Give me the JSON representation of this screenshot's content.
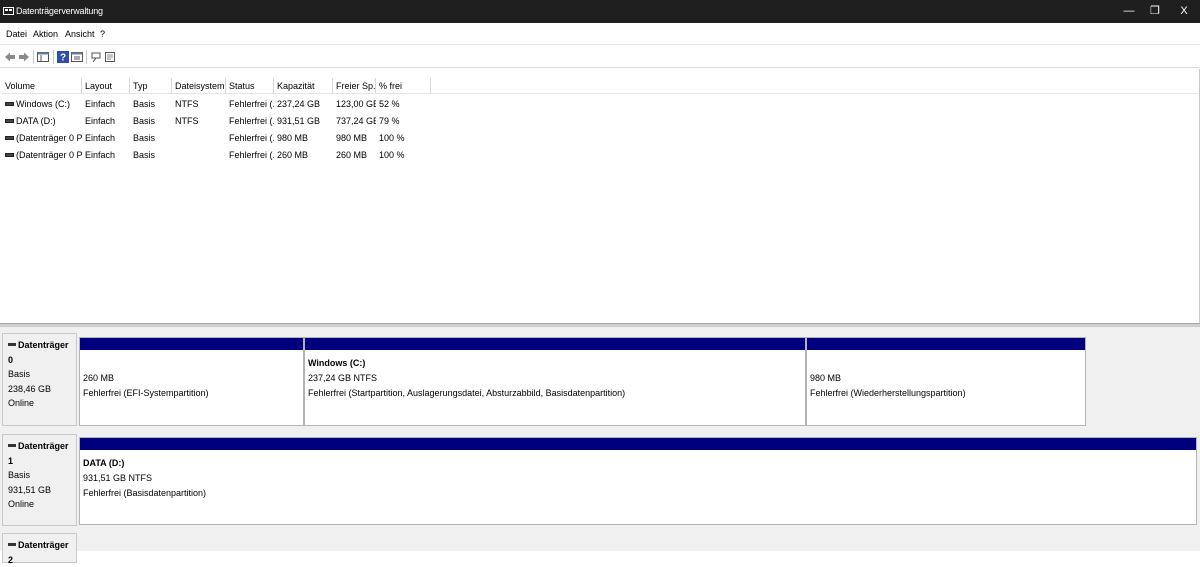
{
  "window": {
    "title": "Datenträgerverwaltung",
    "minimize": "—",
    "restore": "❐",
    "close": "X"
  },
  "menu": [
    "Datei",
    "Aktion",
    "Ansicht",
    "?"
  ],
  "toolbar": {
    "icons": [
      "back-icon",
      "forward-icon",
      "console-tree-icon",
      "help-icon",
      "properties-icon",
      "connect-icon",
      "settings-icon"
    ]
  },
  "volume_list": {
    "columns": [
      "Volume",
      "Layout",
      "Typ",
      "Dateisystem",
      "Status",
      "Kapazität",
      "Freier Sp...",
      "% frei"
    ],
    "rows": [
      [
        "Windows (C:)",
        "Einfach",
        "Basis",
        "NTFS",
        "Fehlerfrei (...",
        "237,24 GB",
        "123,00 GB",
        "52 %"
      ],
      [
        "DATA (D:)",
        "Einfach",
        "Basis",
        "NTFS",
        "Fehlerfrei (...",
        "931,51 GB",
        "737,24 GB",
        "79 %"
      ],
      [
        "(Datenträger 0 Par...",
        "Einfach",
        "Basis",
        "",
        "Fehlerfrei (...",
        "980 MB",
        "980 MB",
        "100 %"
      ],
      [
        "(Datenträger 0 Par...",
        "Einfach",
        "Basis",
        "",
        "Fehlerfrei (...",
        "260 MB",
        "260 MB",
        "100 %"
      ]
    ]
  },
  "disks": [
    {
      "name": "Datenträger 0",
      "type": "Basis",
      "size": "238,46 GB",
      "state": "Online",
      "partitions": [
        {
          "name": "",
          "size": "260 MB",
          "status": "Fehlerfrei (EFI-Systempartition)"
        },
        {
          "name": "Windows  (C:)",
          "size": "237,24 GB NTFS",
          "status": "Fehlerfrei (Startpartition, Auslagerungsdatei, Absturzabbild, Basisdatenpartition)"
        },
        {
          "name": "",
          "size": "980 MB",
          "status": "Fehlerfrei (Wiederherstellungspartition)"
        }
      ]
    },
    {
      "name": "Datenträger 1",
      "type": "Basis",
      "size": "931,51 GB",
      "state": "Online",
      "partitions": [
        {
          "name": "DATA  (D:)",
          "size": "931,51 GB NTFS",
          "status": "Fehlerfrei (Basisdatenpartition)"
        }
      ]
    },
    {
      "name": "Datenträger 2"
    }
  ],
  "colors": {
    "titlebar": "#1f1f1f",
    "partition_primary": "#00007f"
  }
}
